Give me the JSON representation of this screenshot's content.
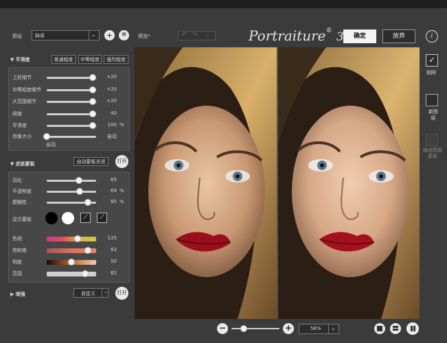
{
  "preset": {
    "label": "预设",
    "value": "缺省"
  },
  "preview_label": "预览",
  "preview_star": "*",
  "logo": {
    "text": "Portraiture",
    "mark": "®",
    "version": "3"
  },
  "actions": {
    "ok": "确定",
    "cancel": "放弃",
    "info": "i"
  },
  "smoothing": {
    "title": "平滑度",
    "presets": [
      "普通程度",
      "中等程度",
      "强烈程度"
    ],
    "rows": [
      {
        "label": "上好细节",
        "value": "+20",
        "fraction": 0.93
      },
      {
        "label": "中等程度细节",
        "value": "+20",
        "fraction": 0.93
      },
      {
        "label": "大范围细节",
        "value": "+20",
        "fraction": 0.93
      },
      {
        "label": "阈值",
        "value": "40",
        "fraction": 0.93
      },
      {
        "label": "平滑度",
        "value": "100",
        "unit": "%",
        "fraction": 0.93
      }
    ],
    "portrait_size": {
      "label": "肖像大小",
      "value": "自动",
      "sub": "自动",
      "fraction": 0.0
    }
  },
  "skin_mask": {
    "title": "皮肤蒙板",
    "auto_btn": "自动蒙板关闭",
    "toggle": "打开",
    "rows": [
      {
        "label": "羽化",
        "value": "65",
        "fraction": 0.65
      },
      {
        "label": "不透明度",
        "value": "69",
        "unit": "%",
        "fraction": 0.67
      },
      {
        "label": "模糊性",
        "value": "85",
        "unit": "%",
        "fraction": 0.83
      }
    ],
    "show_mask": "显示蒙板",
    "color_rows": [
      {
        "label": "色相",
        "value": "125",
        "fraction": 0.63
      },
      {
        "label": "饱和度",
        "value": "83",
        "fraction": 0.83
      },
      {
        "label": "明度",
        "value": "50",
        "fraction": 0.5
      },
      {
        "label": "范围",
        "value": "82",
        "fraction": 0.78
      }
    ]
  },
  "enhance": {
    "title": "增强",
    "preset": "自定义",
    "toggle": "打开"
  },
  "right_panel": {
    "single": "相网",
    "new_layer": "新图层",
    "output_mask": "输出图层蒙板"
  },
  "zoom": {
    "value": "56%",
    "minus": "−",
    "plus": "+",
    "fraction": 0.25
  }
}
